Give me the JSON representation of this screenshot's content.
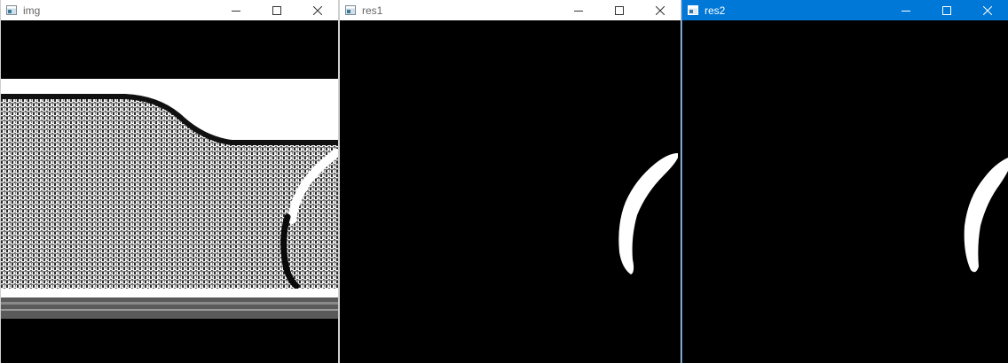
{
  "windows": [
    {
      "title": "img",
      "active": false,
      "icon": "app-window-icon",
      "controls": [
        "minimize-icon",
        "maximize-icon",
        "close-icon"
      ]
    },
    {
      "title": "res1",
      "active": false,
      "icon": "app-window-icon",
      "controls": [
        "minimize-icon",
        "maximize-icon",
        "close-icon"
      ]
    },
    {
      "title": "res2",
      "active": true,
      "icon": "app-window-icon",
      "controls": [
        "minimize-icon",
        "maximize-icon",
        "close-icon"
      ]
    }
  ],
  "colors": {
    "active_titlebar": "#0078d7",
    "inactive_titlebar": "#ffffff",
    "canvas_background": "#000000",
    "mask_foreground": "#ffffff"
  }
}
